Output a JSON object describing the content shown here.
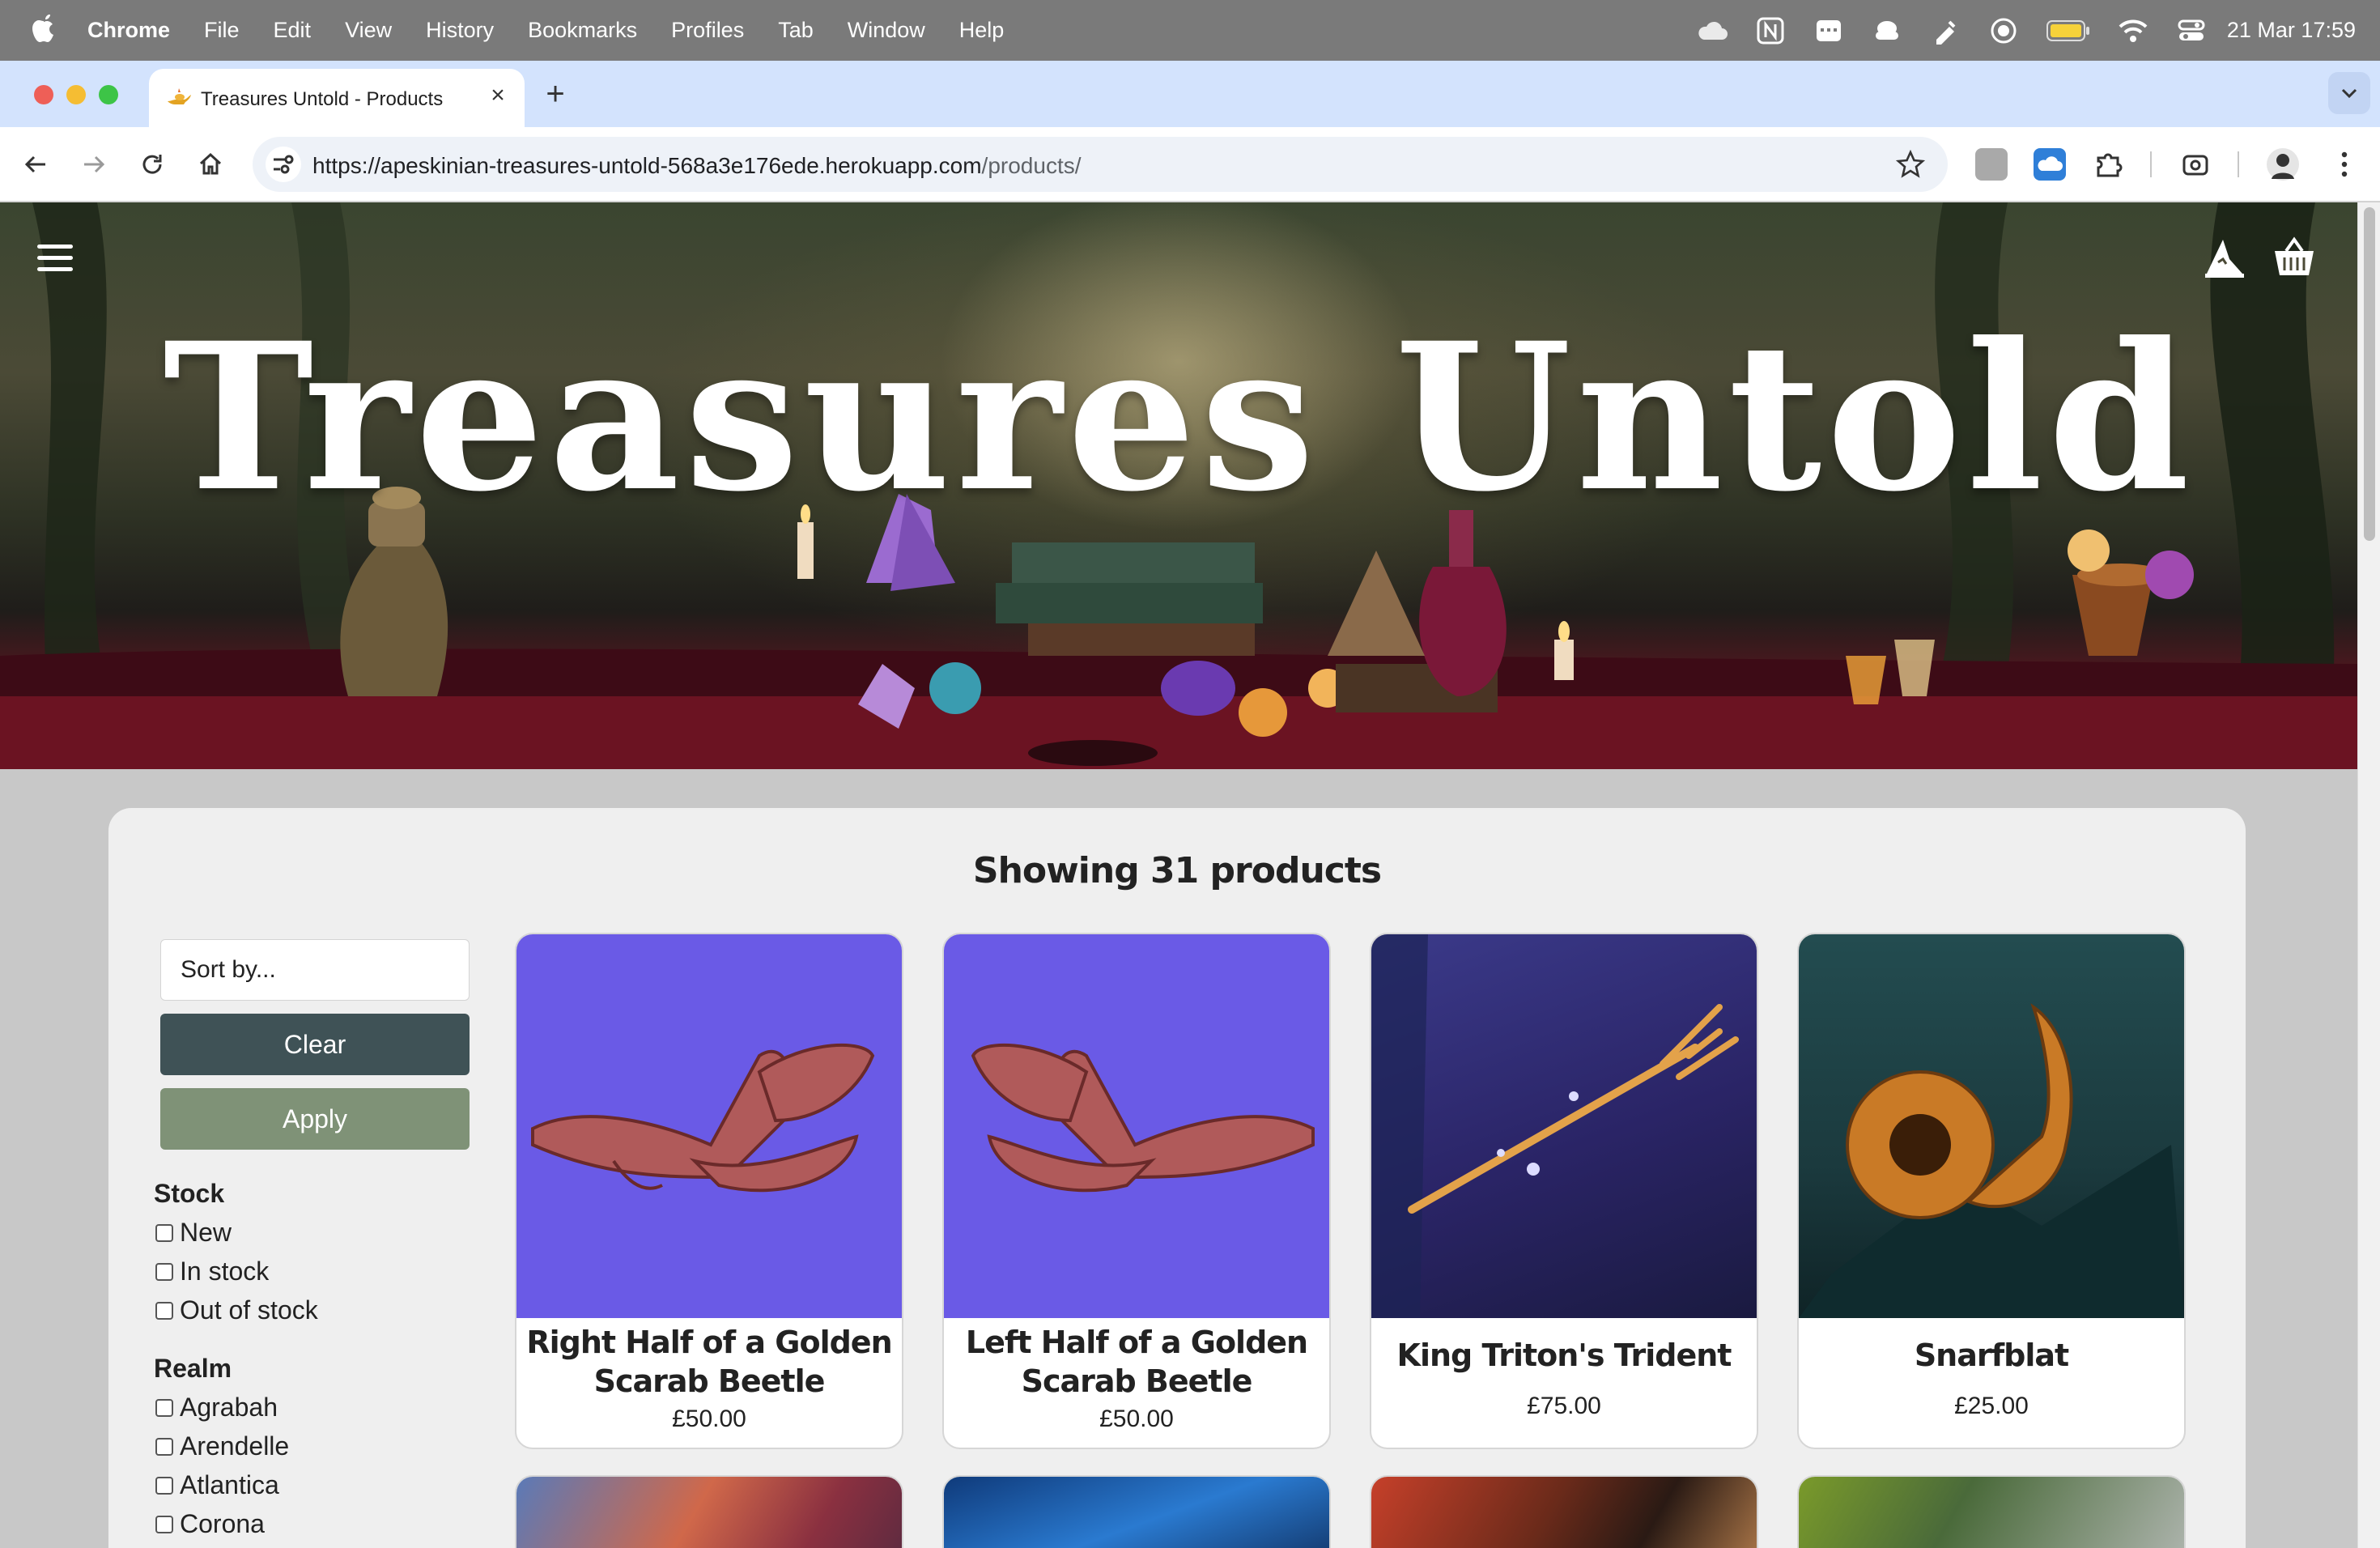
{
  "menubar": {
    "app_name": "Chrome",
    "menus": [
      "File",
      "Edit",
      "View",
      "History",
      "Bookmarks",
      "Profiles",
      "Tab",
      "Window",
      "Help"
    ],
    "clock": "21 Mar  17:59",
    "status_icons": [
      "cloud-icon",
      "notion-icon",
      "calendar-icon",
      "drive-icon",
      "script-icon",
      "focus-icon",
      "battery-icon",
      "wifi-icon",
      "control-center-icon"
    ]
  },
  "browser": {
    "tab_title": "Treasures Untold - Products",
    "url_main": "https://apeskinian-treasures-untold-568a3e176ede.herokuapp.com",
    "url_path": "/products/",
    "colors": {
      "tabstrip": "#d3e3fd",
      "omnibox": "#eef2f8"
    }
  },
  "hero": {
    "title": "Treasures Untold"
  },
  "products_page": {
    "count_text": "Showing 31 products",
    "sort_placeholder": "Sort by...",
    "clear_label": "Clear",
    "apply_label": "Apply",
    "colors": {
      "clear": "#3f5256",
      "apply": "#7f9277"
    },
    "filters": {
      "stock": {
        "heading": "Stock",
        "options": [
          "New",
          "In stock",
          "Out of stock"
        ]
      },
      "realm": {
        "heading": "Realm",
        "options": [
          "Agrabah",
          "Arendelle",
          "Atlantica",
          "Corona"
        ]
      }
    },
    "products": [
      {
        "name": "Right Half of a Golden Scarab Beetle",
        "price": "£50.00"
      },
      {
        "name": "Left Half of a Golden Scarab Beetle",
        "price": "£50.00"
      },
      {
        "name": "King Triton's Trident",
        "price": "£75.00"
      },
      {
        "name": "Snarfblat",
        "price": "£25.00"
      }
    ]
  }
}
